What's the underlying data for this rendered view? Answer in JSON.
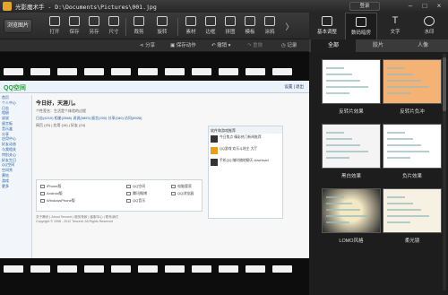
{
  "window": {
    "title": "光影魔术手 - D:\\Documents\\Pictures\\001.jpg",
    "login": "登录",
    "min": "–",
    "max": "□",
    "close": "×"
  },
  "toolbar": {
    "browse": "浏览图片",
    "tools": [
      "打开",
      "保存",
      "另存",
      "尺寸",
      "裁剪",
      "旋转",
      "素材",
      "边框",
      "拼图",
      "模板",
      "涂鸦"
    ],
    "more": "〉"
  },
  "modes": [
    "基本调整",
    "数码暗房",
    "文字",
    "水印"
  ],
  "subbar": {
    "share": "分享",
    "save_action": "保存动作",
    "undo": "撤销",
    "redo": "重做",
    "history": "记录"
  },
  "categories": [
    "全部",
    "胶片",
    "人像"
  ],
  "effects": [
    {
      "label": "反转片效果",
      "tone": "#ffffff"
    },
    {
      "label": "反转片负冲",
      "tone": "#f4b374"
    },
    {
      "label": "黑白效果",
      "tone": "#f4f4f4"
    },
    {
      "label": "负片效果",
      "tone": "#ffffff"
    },
    {
      "label": "LOMO风格",
      "tone": "#e8d8a8"
    },
    {
      "label": "柔光镜",
      "tone": "#f7f1e4"
    }
  ],
  "webpage": {
    "logo": "QQ空间",
    "links": "设置 | 退出",
    "sidebar": [
      "首页",
      "个人中心",
      "日志",
      "相册",
      "说说",
      "留言板",
      "音乐盒",
      "分享",
      "应用中心",
      "好友动态",
      "与我相关",
      "特别关心",
      "好友生日",
      "QQ空间",
      "空间秀",
      "黄钻",
      "游戏",
      "更多"
    ],
    "greeting": "今日好，天涯儿。",
    "lines": [
      "个性签名：生活是个体验的过程",
      "日志(4210) 相册(2866) 说说(5893) 留言(200) 分享(180) 访问(8928)",
      "网页 (20) | 应用 (16) | 好友 (24)"
    ],
    "right_header": "软件和游戏推荐",
    "right_items": [
      {
        "name": "今日焦点 精彩热门新闻推荐",
        "kind": "dark"
      },
      {
        "name": "QQ游戏 欢乐斗地主 大厅",
        "kind": "qq"
      },
      {
        "name": "手机QQ 随时随地聊天 download",
        "kind": "dark"
      }
    ],
    "panel_rows": [
      "iPhone版",
      "Android版",
      "WindowsPhone版",
      "QQ空间",
      "腾讯微博",
      "QQ音乐",
      "电脑管家",
      "QQ浏览器"
    ],
    "footer": [
      "关于腾讯 | About Tencent | 服务条款 | 客服中心 | 联系我们",
      "Copyright © 1998 - 2012 Tencent. All Rights Reserved"
    ]
  }
}
